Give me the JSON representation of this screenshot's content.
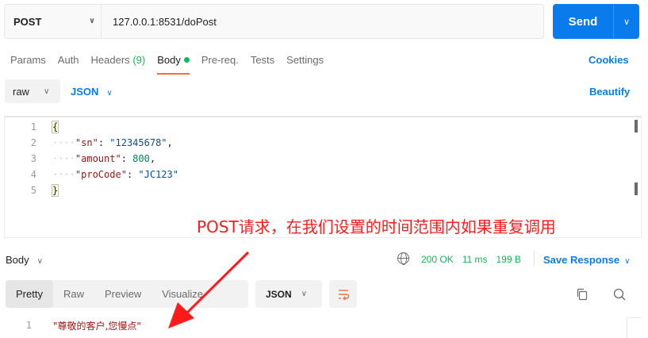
{
  "request": {
    "method": "POST",
    "url": "127.0.0.1:8531/doPost",
    "send_label": "Send"
  },
  "tabs": [
    {
      "label": "Params"
    },
    {
      "label": "Auth"
    },
    {
      "label": "Headers",
      "count": "(9)"
    },
    {
      "label": "Body"
    },
    {
      "label": "Pre-req."
    },
    {
      "label": "Tests"
    },
    {
      "label": "Settings"
    }
  ],
  "cookies_label": "Cookies",
  "body_mode": "raw",
  "body_format": "JSON",
  "beautify_label": "Beautify",
  "editor": {
    "line_numbers": [
      "1",
      "2",
      "3",
      "4",
      "5"
    ],
    "lines": [
      {
        "open": "{"
      },
      {
        "key": "\"sn\"",
        "value": "\"12345678\"",
        "value_type": "str",
        "trail": ","
      },
      {
        "key": "\"amount\"",
        "value": "800",
        "value_type": "num",
        "trail": ","
      },
      {
        "key": "\"proCode\"",
        "value": "\"JC123\"",
        "value_type": "str",
        "trail": ""
      },
      {
        "close": "}"
      }
    ]
  },
  "annotation_text": "POST请求，在我们设置的时间范围内如果重复调用",
  "response": {
    "body_label": "Body",
    "status": "200 OK",
    "time": "11 ms",
    "size": "199 B",
    "save_label": "Save Response",
    "tabs": [
      "Pretty",
      "Raw",
      "Preview",
      "Visualize"
    ],
    "format": "JSON",
    "line_number": "1",
    "line_text": "\"尊敬的客户,您慢点\""
  },
  "colors": {
    "accent": "#097bed",
    "active_tab_underline": "#ff6c37",
    "status_green": "#0cbb52",
    "annotation_red": "#ff1b1b"
  }
}
